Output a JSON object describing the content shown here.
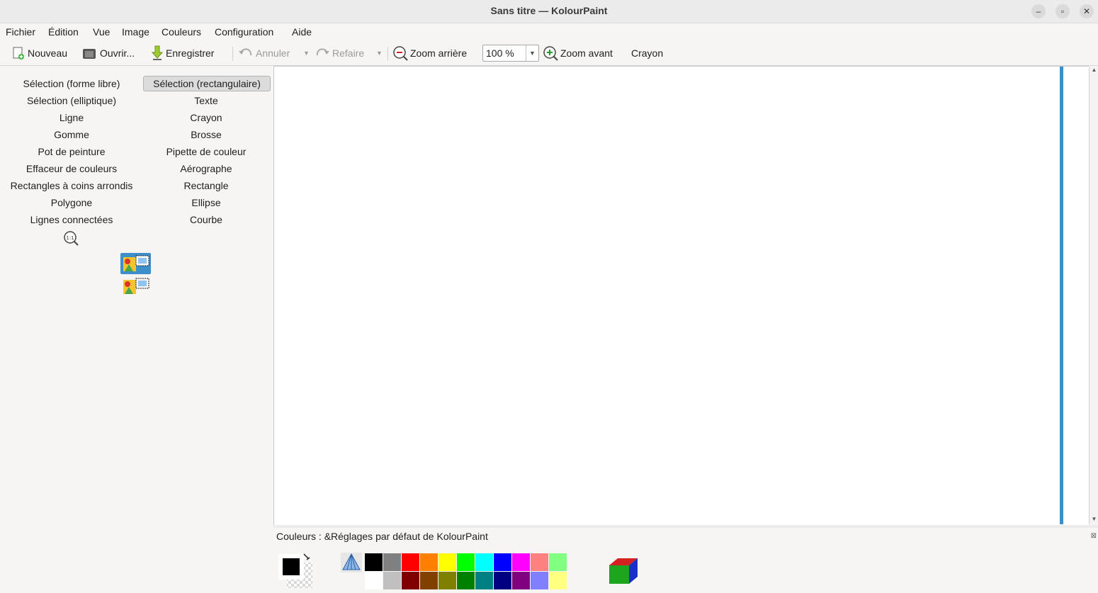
{
  "window": {
    "title": "Sans titre  — KolourPaint"
  },
  "menu": [
    "Fichier",
    "Édition",
    "Vue",
    "Image",
    "Couleurs",
    "Configuration",
    "Aide"
  ],
  "toolbar": {
    "new": "Nouveau",
    "open": "Ouvrir...",
    "save": "Enregistrer",
    "undo": "Annuler",
    "redo": "Refaire",
    "zoom_out": "Zoom arrière",
    "zoom_value": "100 %",
    "zoom_in": "Zoom avant",
    "current_tool": "Crayon"
  },
  "tools": {
    "col1": [
      "Sélection (forme libre)",
      "Sélection (elliptique)",
      "Ligne",
      "Gomme",
      "Pot de peinture",
      "Effaceur de couleurs",
      "Rectangles à coins arrondis",
      "Polygone",
      "Lignes connectées"
    ],
    "col2": [
      "Sélection (rectangulaire)",
      "Texte",
      "Crayon",
      "Brosse",
      "Pipette de couleur",
      "Aérographe",
      "Rectangle",
      "Ellipse",
      "Courbe"
    ],
    "active": "Sélection (rectangulaire)"
  },
  "colors": {
    "label": "Couleurs : &Réglages par défaut de KolourPaint",
    "foreground": "#000000",
    "background": "#ffffff",
    "palette_row1": [
      "#000000",
      "#808080",
      "#ff0000",
      "#ff8000",
      "#ffff00",
      "#00ff00",
      "#00ffff",
      "#0000ff",
      "#ff00ff",
      "#ff8080",
      "#80ff80"
    ],
    "palette_row2": [
      "#ffffff",
      "#c0c0c0",
      "#800000",
      "#804000",
      "#808000",
      "#008000",
      "#008080",
      "#000080",
      "#800080",
      "#8080ff",
      "#ffff80"
    ]
  }
}
